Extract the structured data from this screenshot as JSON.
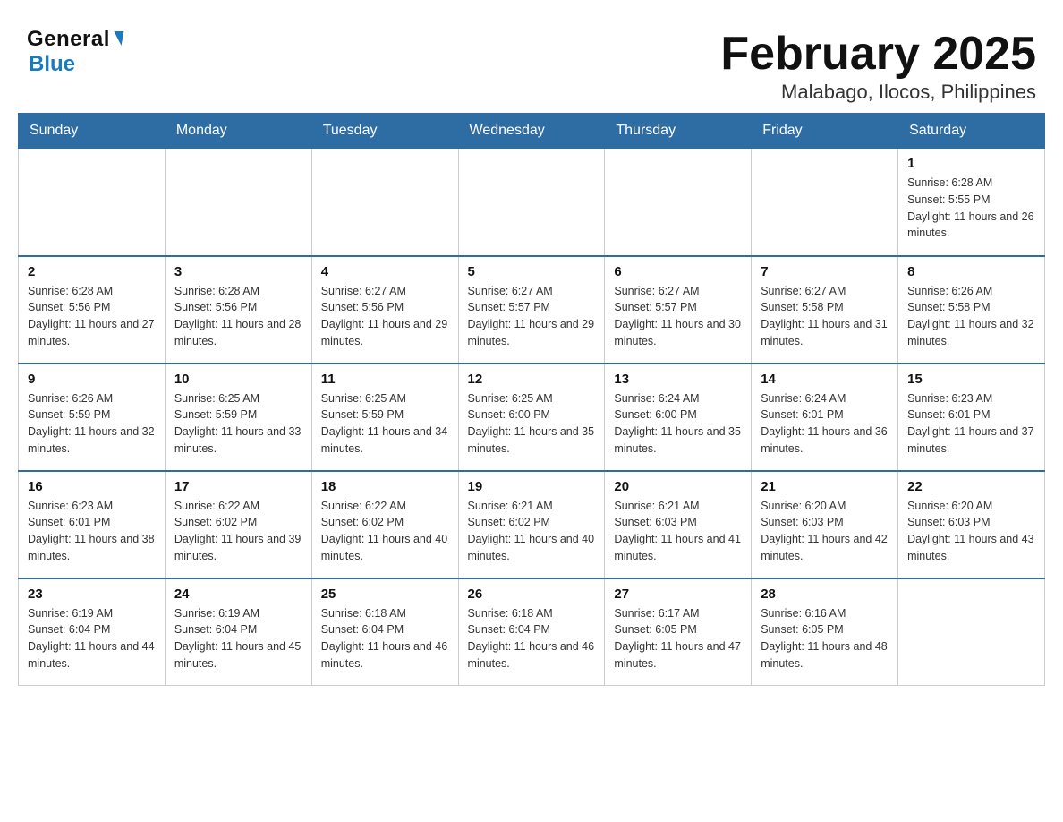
{
  "header": {
    "logo_general": "General",
    "logo_blue": "Blue",
    "title": "February 2025",
    "subtitle": "Malabago, Ilocos, Philippines"
  },
  "days_of_week": [
    "Sunday",
    "Monday",
    "Tuesday",
    "Wednesday",
    "Thursday",
    "Friday",
    "Saturday"
  ],
  "weeks": [
    [
      {
        "day": "",
        "sunrise": "",
        "sunset": "",
        "daylight": ""
      },
      {
        "day": "",
        "sunrise": "",
        "sunset": "",
        "daylight": ""
      },
      {
        "day": "",
        "sunrise": "",
        "sunset": "",
        "daylight": ""
      },
      {
        "day": "",
        "sunrise": "",
        "sunset": "",
        "daylight": ""
      },
      {
        "day": "",
        "sunrise": "",
        "sunset": "",
        "daylight": ""
      },
      {
        "day": "",
        "sunrise": "",
        "sunset": "",
        "daylight": ""
      },
      {
        "day": "1",
        "sunrise": "Sunrise: 6:28 AM",
        "sunset": "Sunset: 5:55 PM",
        "daylight": "Daylight: 11 hours and 26 minutes."
      }
    ],
    [
      {
        "day": "2",
        "sunrise": "Sunrise: 6:28 AM",
        "sunset": "Sunset: 5:56 PM",
        "daylight": "Daylight: 11 hours and 27 minutes."
      },
      {
        "day": "3",
        "sunrise": "Sunrise: 6:28 AM",
        "sunset": "Sunset: 5:56 PM",
        "daylight": "Daylight: 11 hours and 28 minutes."
      },
      {
        "day": "4",
        "sunrise": "Sunrise: 6:27 AM",
        "sunset": "Sunset: 5:56 PM",
        "daylight": "Daylight: 11 hours and 29 minutes."
      },
      {
        "day": "5",
        "sunrise": "Sunrise: 6:27 AM",
        "sunset": "Sunset: 5:57 PM",
        "daylight": "Daylight: 11 hours and 29 minutes."
      },
      {
        "day": "6",
        "sunrise": "Sunrise: 6:27 AM",
        "sunset": "Sunset: 5:57 PM",
        "daylight": "Daylight: 11 hours and 30 minutes."
      },
      {
        "day": "7",
        "sunrise": "Sunrise: 6:27 AM",
        "sunset": "Sunset: 5:58 PM",
        "daylight": "Daylight: 11 hours and 31 minutes."
      },
      {
        "day": "8",
        "sunrise": "Sunrise: 6:26 AM",
        "sunset": "Sunset: 5:58 PM",
        "daylight": "Daylight: 11 hours and 32 minutes."
      }
    ],
    [
      {
        "day": "9",
        "sunrise": "Sunrise: 6:26 AM",
        "sunset": "Sunset: 5:59 PM",
        "daylight": "Daylight: 11 hours and 32 minutes."
      },
      {
        "day": "10",
        "sunrise": "Sunrise: 6:25 AM",
        "sunset": "Sunset: 5:59 PM",
        "daylight": "Daylight: 11 hours and 33 minutes."
      },
      {
        "day": "11",
        "sunrise": "Sunrise: 6:25 AM",
        "sunset": "Sunset: 5:59 PM",
        "daylight": "Daylight: 11 hours and 34 minutes."
      },
      {
        "day": "12",
        "sunrise": "Sunrise: 6:25 AM",
        "sunset": "Sunset: 6:00 PM",
        "daylight": "Daylight: 11 hours and 35 minutes."
      },
      {
        "day": "13",
        "sunrise": "Sunrise: 6:24 AM",
        "sunset": "Sunset: 6:00 PM",
        "daylight": "Daylight: 11 hours and 35 minutes."
      },
      {
        "day": "14",
        "sunrise": "Sunrise: 6:24 AM",
        "sunset": "Sunset: 6:01 PM",
        "daylight": "Daylight: 11 hours and 36 minutes."
      },
      {
        "day": "15",
        "sunrise": "Sunrise: 6:23 AM",
        "sunset": "Sunset: 6:01 PM",
        "daylight": "Daylight: 11 hours and 37 minutes."
      }
    ],
    [
      {
        "day": "16",
        "sunrise": "Sunrise: 6:23 AM",
        "sunset": "Sunset: 6:01 PM",
        "daylight": "Daylight: 11 hours and 38 minutes."
      },
      {
        "day": "17",
        "sunrise": "Sunrise: 6:22 AM",
        "sunset": "Sunset: 6:02 PM",
        "daylight": "Daylight: 11 hours and 39 minutes."
      },
      {
        "day": "18",
        "sunrise": "Sunrise: 6:22 AM",
        "sunset": "Sunset: 6:02 PM",
        "daylight": "Daylight: 11 hours and 40 minutes."
      },
      {
        "day": "19",
        "sunrise": "Sunrise: 6:21 AM",
        "sunset": "Sunset: 6:02 PM",
        "daylight": "Daylight: 11 hours and 40 minutes."
      },
      {
        "day": "20",
        "sunrise": "Sunrise: 6:21 AM",
        "sunset": "Sunset: 6:03 PM",
        "daylight": "Daylight: 11 hours and 41 minutes."
      },
      {
        "day": "21",
        "sunrise": "Sunrise: 6:20 AM",
        "sunset": "Sunset: 6:03 PM",
        "daylight": "Daylight: 11 hours and 42 minutes."
      },
      {
        "day": "22",
        "sunrise": "Sunrise: 6:20 AM",
        "sunset": "Sunset: 6:03 PM",
        "daylight": "Daylight: 11 hours and 43 minutes."
      }
    ],
    [
      {
        "day": "23",
        "sunrise": "Sunrise: 6:19 AM",
        "sunset": "Sunset: 6:04 PM",
        "daylight": "Daylight: 11 hours and 44 minutes."
      },
      {
        "day": "24",
        "sunrise": "Sunrise: 6:19 AM",
        "sunset": "Sunset: 6:04 PM",
        "daylight": "Daylight: 11 hours and 45 minutes."
      },
      {
        "day": "25",
        "sunrise": "Sunrise: 6:18 AM",
        "sunset": "Sunset: 6:04 PM",
        "daylight": "Daylight: 11 hours and 46 minutes."
      },
      {
        "day": "26",
        "sunrise": "Sunrise: 6:18 AM",
        "sunset": "Sunset: 6:04 PM",
        "daylight": "Daylight: 11 hours and 46 minutes."
      },
      {
        "day": "27",
        "sunrise": "Sunrise: 6:17 AM",
        "sunset": "Sunset: 6:05 PM",
        "daylight": "Daylight: 11 hours and 47 minutes."
      },
      {
        "day": "28",
        "sunrise": "Sunrise: 6:16 AM",
        "sunset": "Sunset: 6:05 PM",
        "daylight": "Daylight: 11 hours and 48 minutes."
      },
      {
        "day": "",
        "sunrise": "",
        "sunset": "",
        "daylight": ""
      }
    ]
  ]
}
